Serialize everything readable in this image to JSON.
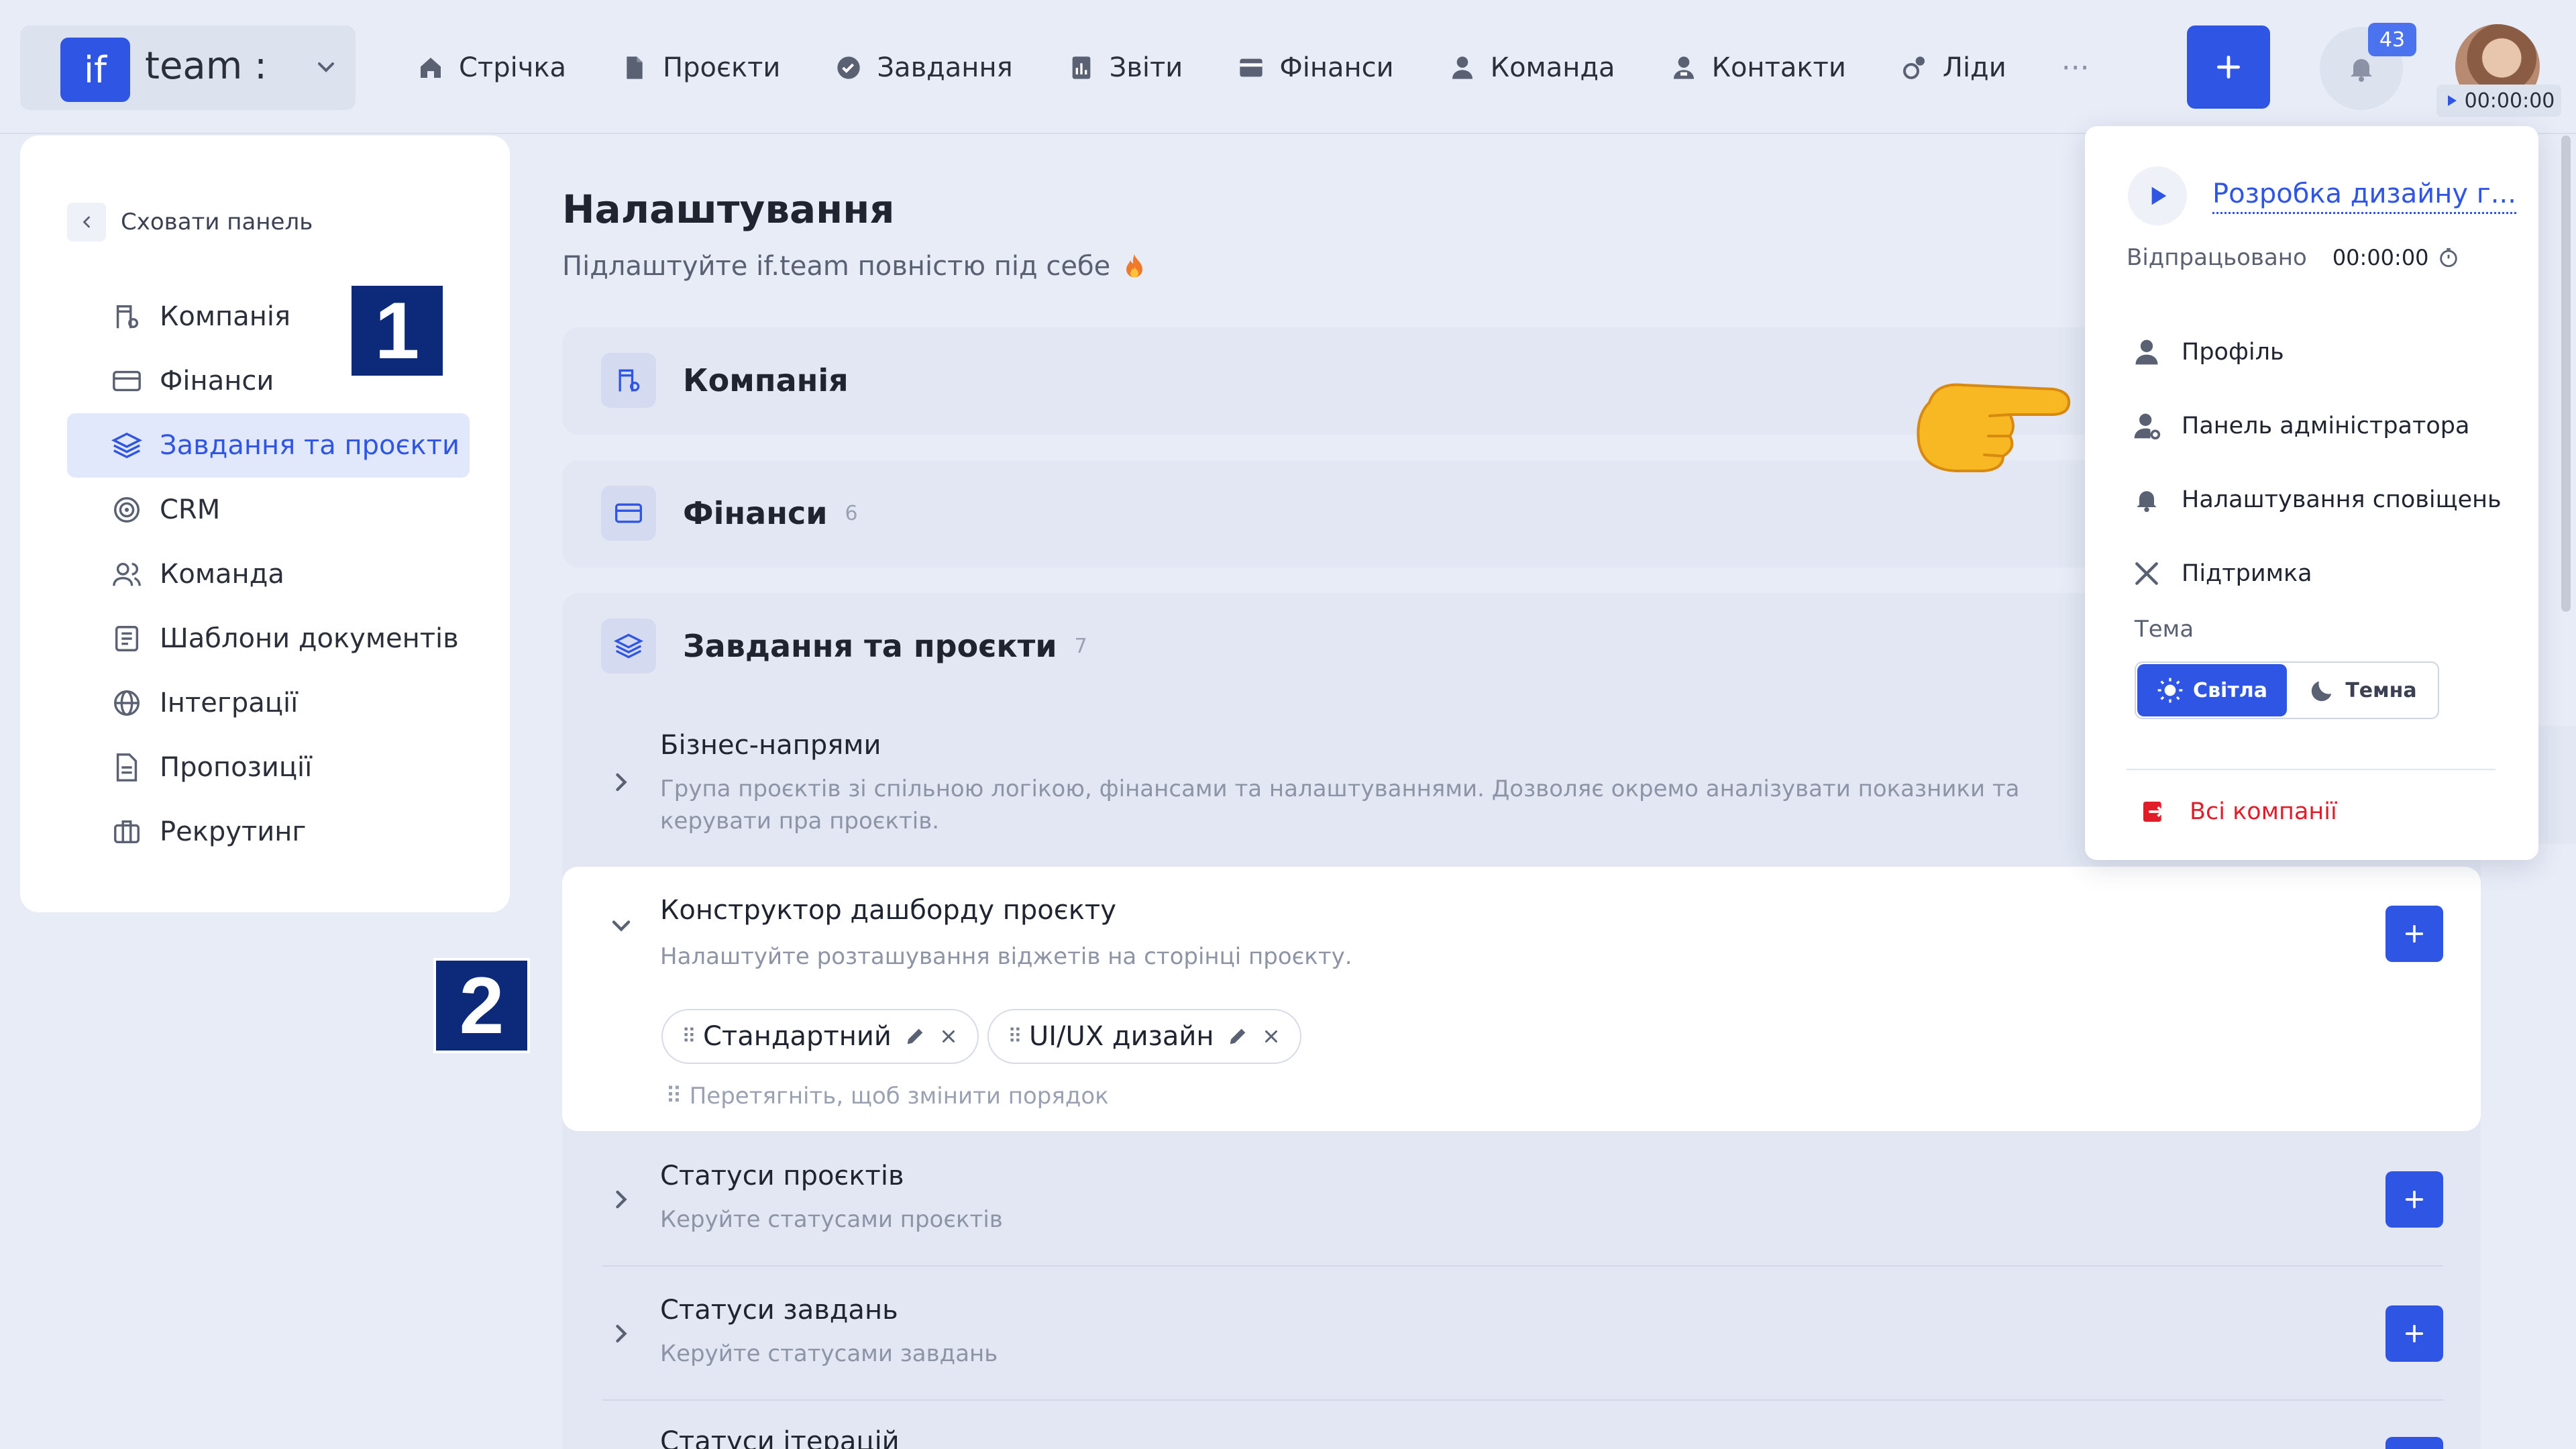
{
  "brand": {
    "logo": "if",
    "name": "team :"
  },
  "nav": [
    {
      "label": "Стрічка",
      "icon": "home-icon"
    },
    {
      "label": "Проєкти",
      "icon": "document-icon"
    },
    {
      "label": "Завдання",
      "icon": "check-circle-icon"
    },
    {
      "label": "Звіти",
      "icon": "report-icon"
    },
    {
      "label": "Фінанси",
      "icon": "wallet-icon"
    },
    {
      "label": "Команда",
      "icon": "user-icon"
    },
    {
      "label": "Контакти",
      "icon": "contacts-icon"
    },
    {
      "label": "Ліди",
      "icon": "leads-icon"
    }
  ],
  "nav_more": "···",
  "notifications": {
    "count": "43"
  },
  "timer": {
    "value": "00:00:00"
  },
  "sidebar": {
    "hide_label": "Сховати панель",
    "items": [
      {
        "label": "Компанія",
        "icon": "company-icon"
      },
      {
        "label": "Фінанси",
        "icon": "card-icon"
      },
      {
        "label": "Завдання та проєкти",
        "icon": "layers-icon",
        "active": true
      },
      {
        "label": "CRM",
        "icon": "target-icon"
      },
      {
        "label": "Команда",
        "icon": "team-icon"
      },
      {
        "label": "Шаблони документів",
        "icon": "template-icon"
      },
      {
        "label": "Інтеграції",
        "icon": "globe-icon"
      },
      {
        "label": "Пропозиції",
        "icon": "proposal-icon"
      },
      {
        "label": "Рекрутинг",
        "icon": "briefcase-icon"
      }
    ]
  },
  "badges": {
    "one": "1",
    "two": "2"
  },
  "main": {
    "title": "Налаштування",
    "subtitle": "Підлаштуйте if.team повністю під себе",
    "cards": {
      "company": {
        "title": "Компанія"
      },
      "finance": {
        "title": "Фінанси",
        "count": "6"
      },
      "tasks": {
        "title": "Завдання та проєкти",
        "count": "7"
      }
    },
    "sections": {
      "business": {
        "title": "Бізнес-напрями",
        "desc": "Група проєктів зі спільною логікою, фінансами та налаштуваннями. Дозволяє окремо аналізувати показники та керувати пра проєктів."
      },
      "dashboard": {
        "title": "Конструктор дашборду проєкту",
        "desc": "Налаштуйте розташування віджетів на сторінці проєкту.",
        "chips": [
          "Стандартний",
          "UI/UX дизайн"
        ],
        "hint": "Перетягніть, щоб змінити порядок"
      },
      "project_statuses": {
        "title": "Статуси проєктів",
        "desc": "Керуйте статусами проєктів"
      },
      "task_statuses": {
        "title": "Статуси завдань",
        "desc": "Керуйте статусами завдань"
      },
      "iteration_statuses": {
        "title": "Статуси ітерацій"
      }
    }
  },
  "dropdown": {
    "task_title": "Розробка дизайну г...",
    "worked_label": "Відпрацьовано",
    "worked_time": "00:00:00",
    "menu": [
      {
        "label": "Профіль",
        "icon": "user-icon"
      },
      {
        "label": "Панель адміністратора",
        "icon": "admin-icon"
      },
      {
        "label": "Налаштування сповіщень",
        "icon": "bell-icon"
      },
      {
        "label": "Підтримка",
        "icon": "tools-icon"
      }
    ],
    "theme_label": "Тема",
    "theme_light": "Світла",
    "theme_dark": "Темна",
    "logout": "Всі компанії"
  },
  "colors": {
    "accent": "#2f55e4",
    "danger": "#e11d2a",
    "badge": "#0d2a7a"
  }
}
